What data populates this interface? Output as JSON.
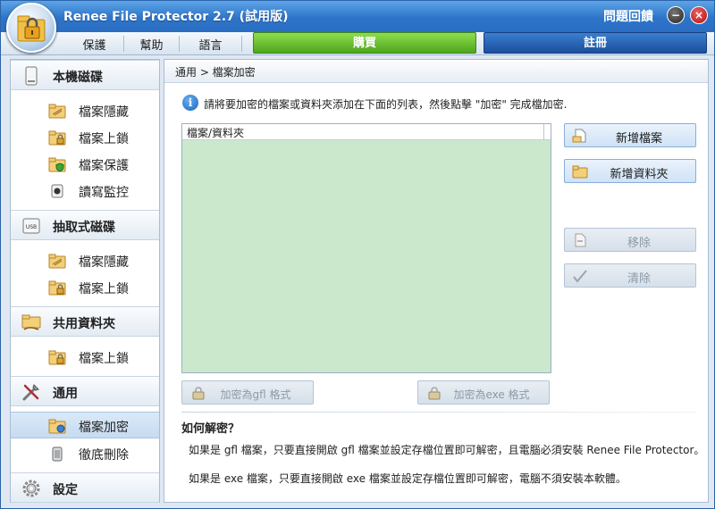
{
  "window": {
    "title": "Renee File Protector 2.7 (試用版)",
    "feedback": "問題回饋",
    "minimize_glyph": "−",
    "close_glyph": "×"
  },
  "menu": {
    "items": [
      "保護",
      "幫助",
      "語言"
    ],
    "buy_label": "購買",
    "register_label": "註冊"
  },
  "colors": {
    "title_bar": "#2d74c9",
    "buy_green": "#5cb82a",
    "register_blue": "#1f56a8",
    "list_background": "#cce8cc"
  },
  "sidebar": {
    "local_disk": {
      "label": "本機磁碟",
      "icon": "hard-drive-icon",
      "items": [
        {
          "label": "檔案隱藏",
          "icon": "hide-folder-icon"
        },
        {
          "label": "檔案上鎖",
          "icon": "lock-folder-icon"
        },
        {
          "label": "檔案保護",
          "icon": "shield-folder-icon"
        },
        {
          "label": "讀寫監控",
          "icon": "monitor-icon"
        }
      ]
    },
    "removable_disk": {
      "label": "抽取式磁碟",
      "icon": "usb-drive-icon",
      "items": [
        {
          "label": "檔案隱藏",
          "icon": "hide-folder-icon"
        },
        {
          "label": "檔案上鎖",
          "icon": "lock-folder-icon"
        }
      ]
    },
    "shared_folder": {
      "label": "共用資料夾",
      "icon": "shared-folder-icon",
      "items": [
        {
          "label": "檔案上鎖",
          "icon": "lock-folder-icon"
        }
      ]
    },
    "general": {
      "label": "通用",
      "icon": "tools-icon",
      "items": [
        {
          "label": "檔案加密",
          "icon": "encrypt-folder-icon",
          "active": true
        },
        {
          "label": "徹底刪除",
          "icon": "shredder-icon"
        }
      ]
    },
    "settings": {
      "label": "設定",
      "icon": "gear-icon"
    }
  },
  "main": {
    "breadcrumb": "通用 > 檔案加密",
    "instruction": "請將要加密的檔案或資料夾添加在下面的列表，然後點擊 \"加密\" 完成檔加密.",
    "list_header": "檔案/資料夾",
    "buttons": {
      "add_file": "新增檔案",
      "add_folder": "新增資料夾",
      "remove": "移除",
      "clear": "清除"
    },
    "encrypt_gfl": "加密為gfl 格式",
    "encrypt_exe": "加密為exe 格式",
    "how_to_title": "如何解密？",
    "how_to_gfl": "如果是 gfl 檔案，只要直接開啟 gfl 檔案並設定存檔位置即可解密，且電腦必須安裝 Renee File Protector。",
    "how_to_exe": "如果是 exe 檔案，只要直接開啟 exe 檔案並設定存檔位置即可解密，電腦不須安裝本軟體。"
  }
}
